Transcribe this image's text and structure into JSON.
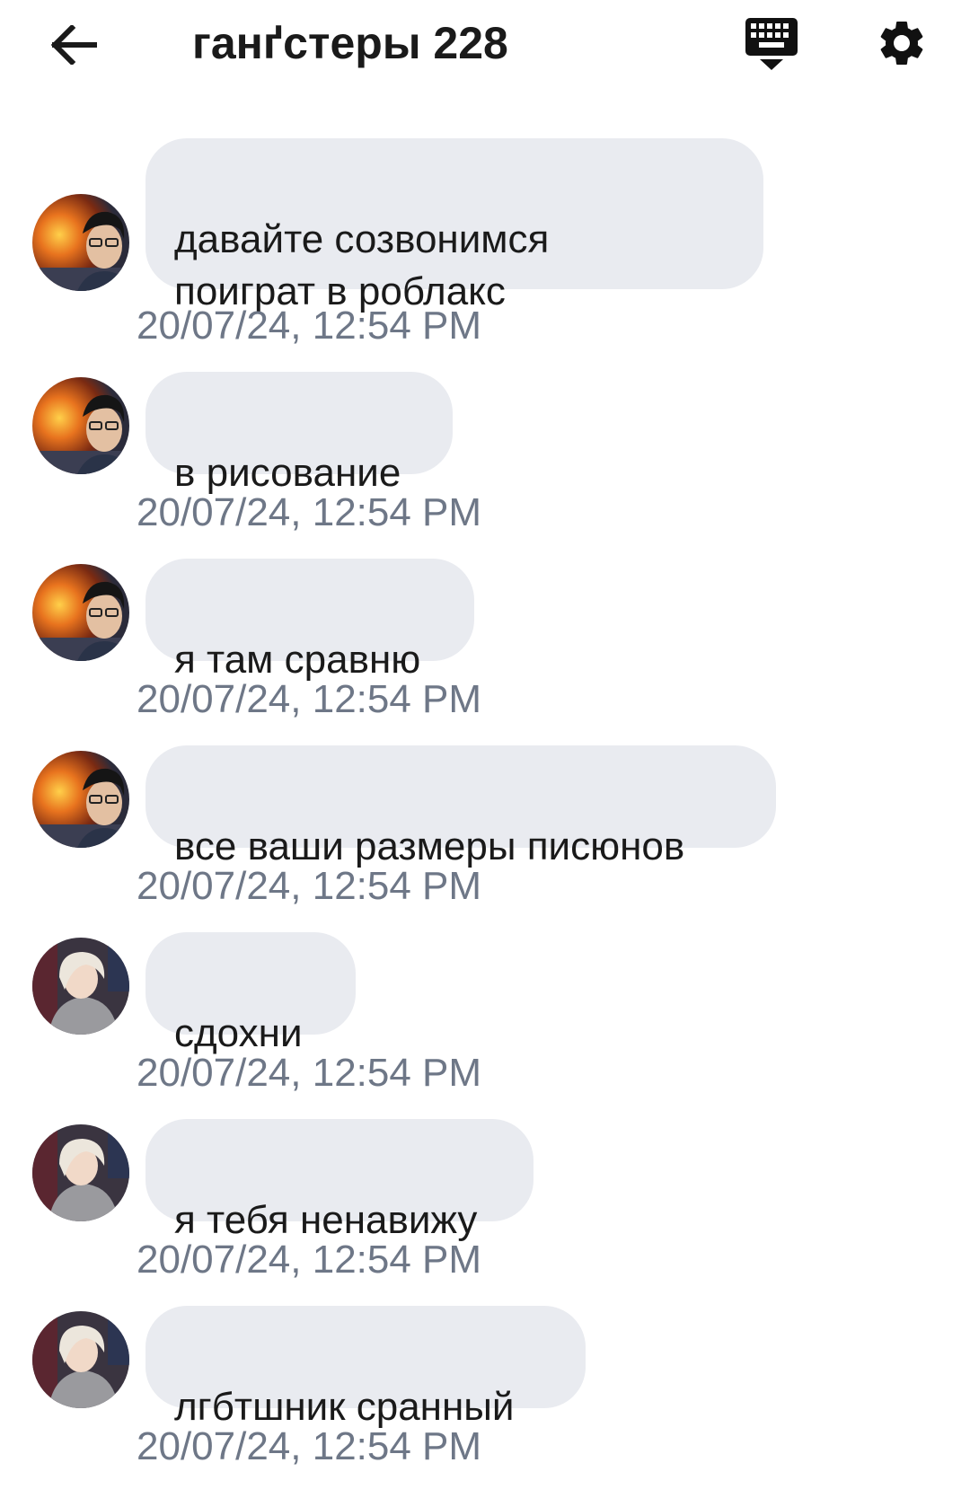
{
  "header": {
    "title": "ганґстеры 228",
    "back_icon": "arrow-left-icon",
    "keyboard_icon": "keyboard-icon",
    "settings_icon": "gear-icon"
  },
  "colors": {
    "bubble": "#e9ebf0",
    "timestamp": "#6e7787",
    "text": "#1a1a1a"
  },
  "messages": [
    {
      "author": "user-1",
      "text": "давайте созвонимся\nпоиграт в роблакс",
      "time": "20/07/24, 12:54 PM"
    },
    {
      "author": "user-1",
      "text": "в рисование",
      "time": "20/07/24, 12:54 PM"
    },
    {
      "author": "user-1",
      "text": "я там сравню",
      "time": "20/07/24, 12:54 PM"
    },
    {
      "author": "user-1",
      "text": "все ваши размеры писюнов",
      "time": "20/07/24, 12:54 PM"
    },
    {
      "author": "user-2",
      "text": "сдохни",
      "time": "20/07/24, 12:54 PM"
    },
    {
      "author": "user-2",
      "text": "я тебя ненавижу",
      "time": "20/07/24, 12:54 PM"
    },
    {
      "author": "user-2",
      "text": "лгбтшник сранный",
      "time": "20/07/24, 12:54 PM"
    }
  ]
}
